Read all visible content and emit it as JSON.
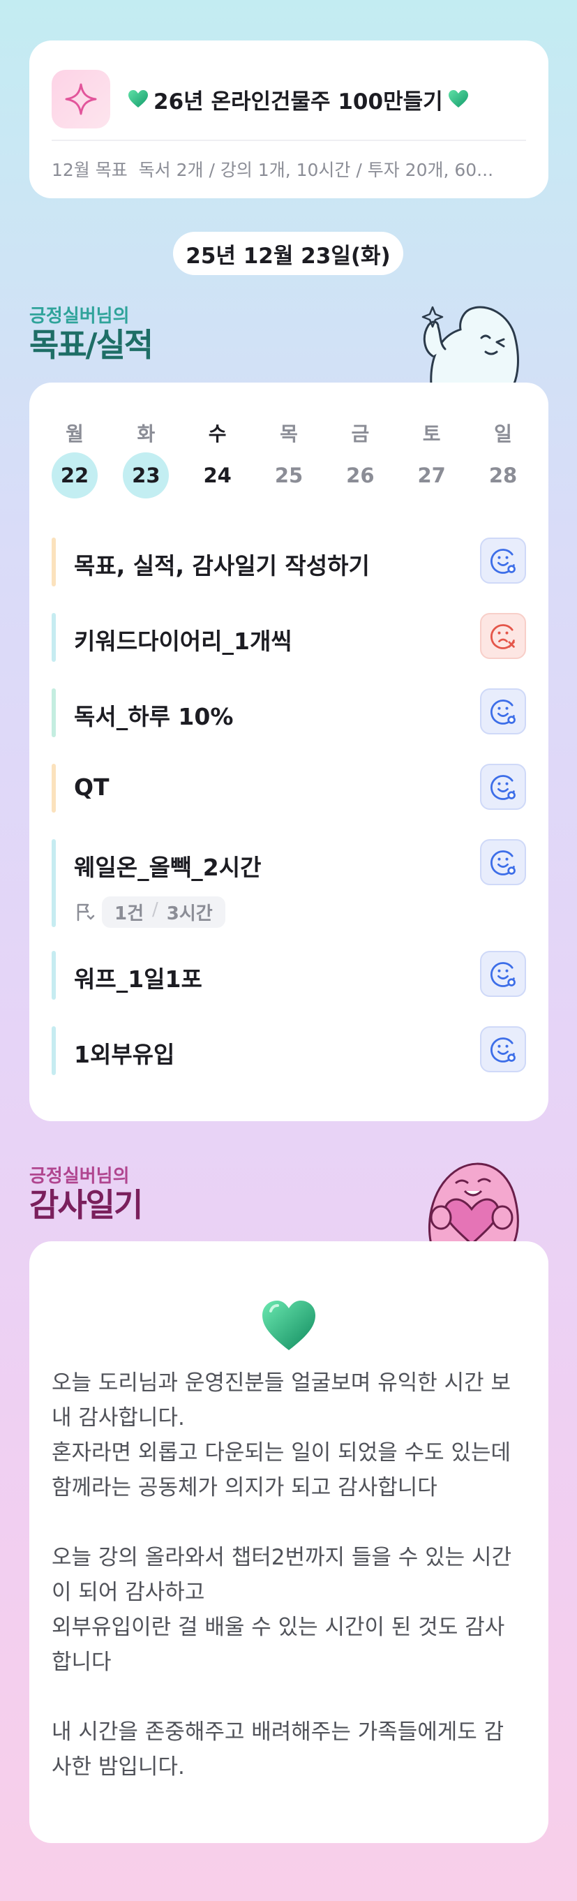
{
  "goal_card": {
    "title": "26년 온라인건물주 100만들기",
    "month_goal_label": "12월 목표",
    "month_goal_text": "독서 2개 / 강의 1개, 10시간 / 투자 20개, 60..."
  },
  "date": "25년 12월 23일(화)",
  "goals_section": {
    "subtitle": "긍정실버님의",
    "title": "목표/실적"
  },
  "week": [
    {
      "label": "월",
      "day": "22",
      "state": "past"
    },
    {
      "label": "화",
      "day": "23",
      "state": "past"
    },
    {
      "label": "수",
      "day": "24",
      "state": "today"
    },
    {
      "label": "목",
      "day": "25",
      "state": "future"
    },
    {
      "label": "금",
      "day": "26",
      "state": "future"
    },
    {
      "label": "토",
      "day": "27",
      "state": "future"
    },
    {
      "label": "일",
      "day": "28",
      "state": "future"
    }
  ],
  "tasks": [
    {
      "name": "목표, 실적, 감사일기 작성하기",
      "bar_color": "#fbe2bd",
      "status": "done"
    },
    {
      "name": "키워드다이어리_1개씩",
      "bar_color": "#c6ecf1",
      "status": "failed"
    },
    {
      "name": "독서_하루 10%",
      "bar_color": "#c4ede0",
      "status": "done"
    },
    {
      "name": "QT",
      "bar_color": "#fbe2bd",
      "status": "done"
    },
    {
      "name": "웨일온_올빽_2시간",
      "bar_color": "#c6ecf1",
      "status": "done",
      "meta_count": "1건",
      "meta_time": "3시간"
    },
    {
      "name": "워프_1일1포",
      "bar_color": "#c6ecf1",
      "status": "done"
    },
    {
      "name": "1외부유입",
      "bar_color": "#c6ecf1",
      "status": "done"
    }
  ],
  "diary_section": {
    "subtitle": "긍정실버님의",
    "title": "감사일기"
  },
  "diary_text": "오늘 도리님과 운영진분들 얼굴보며 유익한 시간 보내 감사합니다.\n혼자라면 외롭고 다운되는 일이 되었을 수도 있는데\n함께라는 공동체가 의지가 되고 감사합니다\n\n오늘 강의 올라와서 챕터2번까지 들을 수 있는 시간이 되어 감사하고\n외부유입이란 걸 배울 수 있는 시간이 된 것도 감사합니다\n\n내 시간을 존중해주고 배려해주는 가족들에게도 감사한 밤입니다.",
  "colors": {
    "goals_title": "#1e6e66",
    "goals_subtitle": "#2fa39a",
    "diary_title": "#7a1f5c",
    "diary_subtitle": "#b0458f",
    "face_good": "#3d6ee8",
    "face_bad": "#e4564a",
    "heart": "#2ec48a"
  },
  "icons": {
    "star": "sparkle-star-icon",
    "heart": "green-heart-icon",
    "flag": "flag-icon"
  }
}
